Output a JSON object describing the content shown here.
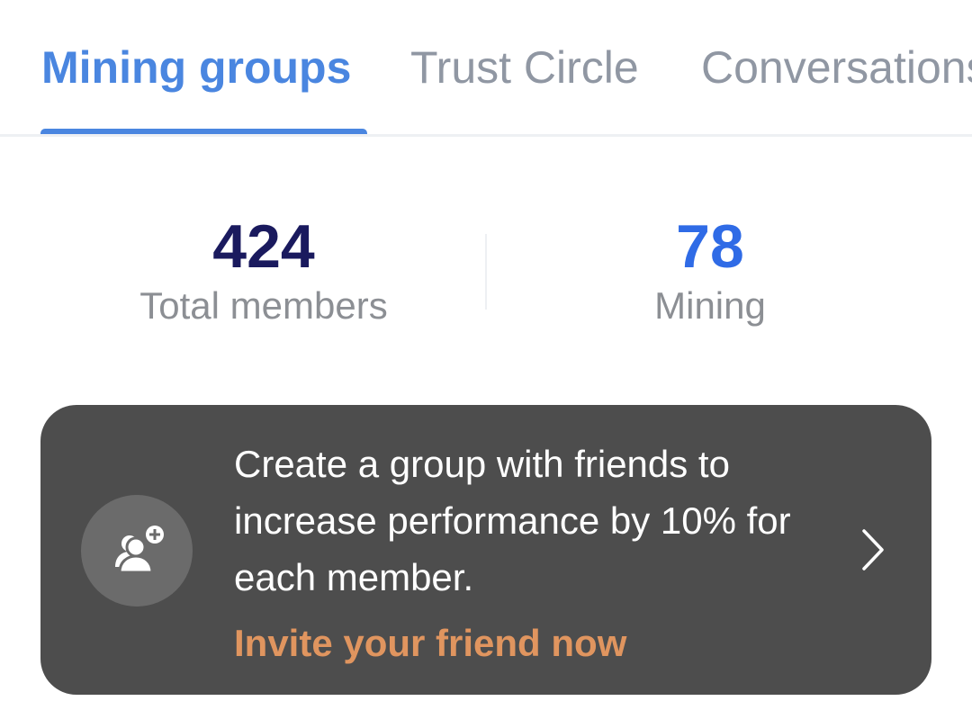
{
  "tabs": [
    {
      "label": "Mining groups",
      "active": true
    },
    {
      "label": "Trust Circle",
      "active": false
    },
    {
      "label": "Conversations",
      "active": false
    }
  ],
  "stats": {
    "total": {
      "value": "424",
      "label": "Total members"
    },
    "mining": {
      "value": "78",
      "label": "Mining"
    }
  },
  "invite": {
    "message": "Create a group with friends to increase performance by 10% for each member.",
    "link_label": "Invite your friend now",
    "icon": "add-group-icon",
    "chevron_icon": "chevron-right-icon"
  },
  "colors": {
    "accent": "#4a86e0",
    "total_value": "#1a1a5e",
    "mining_value": "#2f6be6",
    "card_background": "#4d4d4d",
    "link": "#e0955f"
  }
}
